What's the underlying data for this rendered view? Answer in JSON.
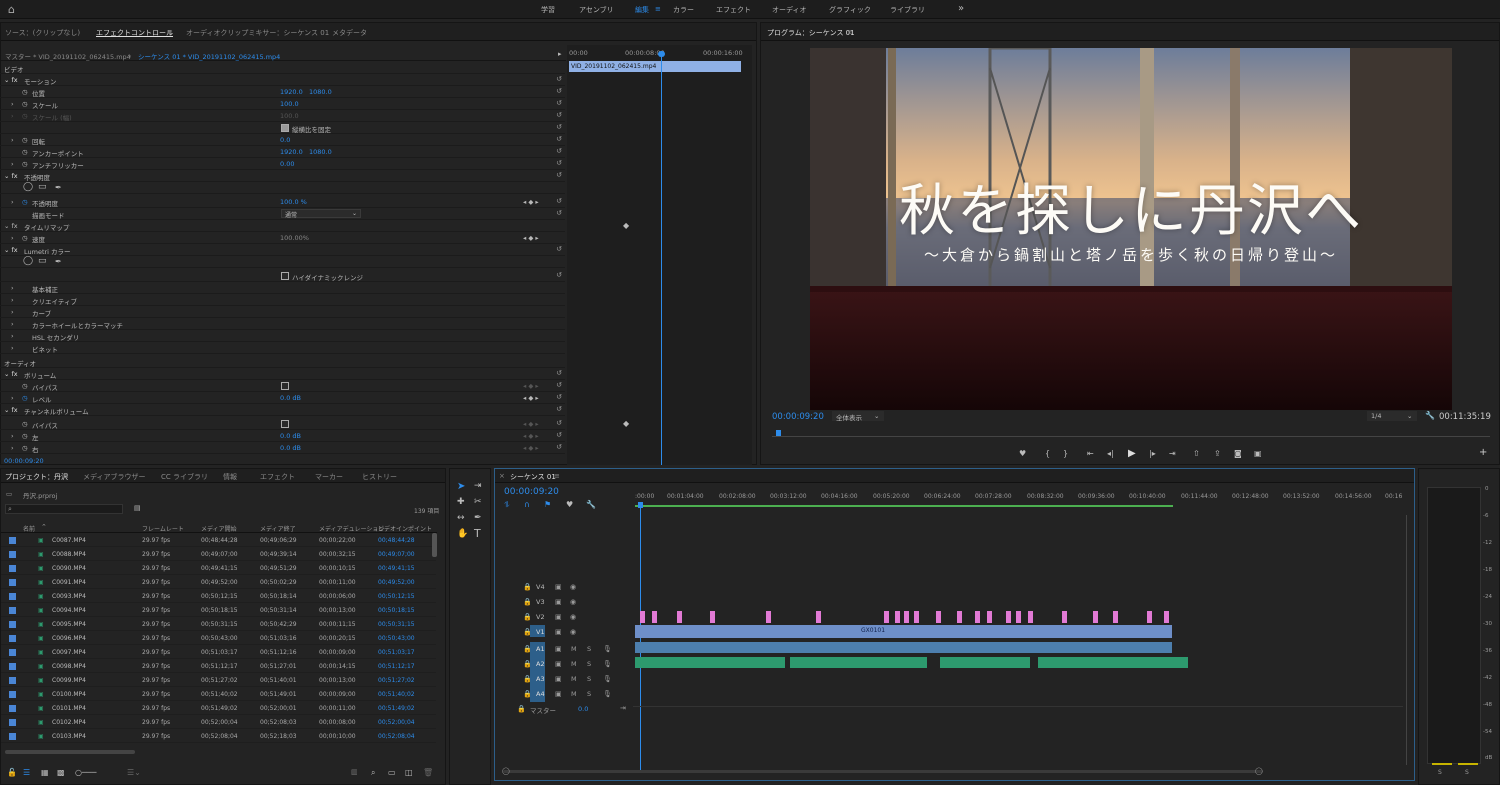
{
  "topbar": {
    "home": "⌂",
    "workspaces": [
      "学習",
      "アセンブリ",
      "編集",
      "カラー",
      "エフェクト",
      "オーディオ",
      "グラフィック",
      "ライブラリ"
    ],
    "active_index": 2,
    "more": "»"
  },
  "source_tabs": {
    "source": "ソース：(クリップなし)",
    "effect_controls": "エフェクトコントロール",
    "audio_mixer": "オーディオクリップミキサー：シーケンス 01",
    "metadata": "メタデータ"
  },
  "effect_controls": {
    "master": "マスター * VID_20191102_062415.mp4",
    "sequence": "シーケンス 01 * VID_20191102_062415.mp4",
    "timecodes": [
      "00:00",
      "00:00:08:00",
      "00:00:16:00"
    ],
    "clip_name": "VID_20191102_062415.mp4",
    "video_header": "ビデオ",
    "audio_header": "オーディオ",
    "current_time": "00:00:09:20",
    "motion": "モーション",
    "position": {
      "label": "位置",
      "x": "1920.0",
      "y": "1080.0"
    },
    "scale": {
      "label": "スケール",
      "value": "100.0"
    },
    "scale_width": {
      "label": "スケール (幅)",
      "value": "100.0"
    },
    "uniform_scale": "縦横比を固定",
    "rotation": {
      "label": "回転",
      "value": "0.0"
    },
    "anchor": {
      "label": "アンカーポイント",
      "x": "1920.0",
      "y": "1080.0"
    },
    "antiflicker": {
      "label": "アンチフリッカー",
      "value": "0.00"
    },
    "opacity": "不透明度",
    "opacity_value": {
      "label": "不透明度",
      "value": "100.0 %"
    },
    "blend": {
      "label": "描画モード",
      "value": "通常"
    },
    "timeremap": "タイムリマップ",
    "speed": {
      "label": "速度",
      "value": "100.00%"
    },
    "lumetri": "Lumetri カラー",
    "hdr": "ハイダイナミックレンジ",
    "lumetri_sections": [
      "基本補正",
      "クリエイティブ",
      "カーブ",
      "カラーホイールとカラーマッチ",
      "HSL セカンダリ",
      "ビネット"
    ],
    "volume": "ボリューム",
    "bypass": "バイパス",
    "level": {
      "label": "レベル",
      "value": "0.0 dB"
    },
    "channel_volume": "チャンネルボリューム",
    "left": {
      "label": "左",
      "value": "0.0 dB"
    },
    "right": {
      "label": "右",
      "value": "0.0 dB"
    }
  },
  "program": {
    "title": "プログラム：シーケンス 01",
    "main_title": "秋を探しに丹沢へ",
    "subtitle": "〜大倉から鍋割山と塔ノ岳を歩く秋の日帰り登山〜",
    "current_time": "00:00:09:20",
    "fit": "全体表示",
    "resolution": "1/4",
    "duration": "00:11:35:19"
  },
  "project": {
    "tabs": [
      "プロジェクト：丹沢",
      "メディアブラウザー",
      "CC ライブラリ",
      "情報",
      "エフェクト",
      "マーカー",
      "ヒストリー"
    ],
    "file": "丹沢.prproj",
    "item_count": "139 項目",
    "columns": [
      "名前",
      "フレームレート",
      "メディア開始",
      "メディア終了",
      "メディアデュレーション",
      "ビデオインポイント"
    ],
    "rows": [
      [
        "C0087.MP4",
        "29.97 fps",
        "00;48;44;28",
        "00;49;06;29",
        "00;00;22;00",
        "00;48;44;28"
      ],
      [
        "C0088.MP4",
        "29.97 fps",
        "00;49;07;00",
        "00;49;39;14",
        "00;00;32;15",
        "00;49;07;00"
      ],
      [
        "C0090.MP4",
        "29.97 fps",
        "00;49;41;15",
        "00;49;51;29",
        "00;00;10;15",
        "00;49;41;15"
      ],
      [
        "C0091.MP4",
        "29.97 fps",
        "00;49;52;00",
        "00;50;02;29",
        "00;00;11;00",
        "00;49;52;00"
      ],
      [
        "C0093.MP4",
        "29.97 fps",
        "00;50;12;15",
        "00;50;18;14",
        "00;00;06;00",
        "00;50;12;15"
      ],
      [
        "C0094.MP4",
        "29.97 fps",
        "00;50;18;15",
        "00;50;31;14",
        "00;00;13;00",
        "00;50;18;15"
      ],
      [
        "C0095.MP4",
        "29.97 fps",
        "00;50;31;15",
        "00;50;42;29",
        "00;00;11;15",
        "00;50;31;15"
      ],
      [
        "C0096.MP4",
        "29.97 fps",
        "00;50;43;00",
        "00;51;03;16",
        "00;00;20;15",
        "00;50;43;00"
      ],
      [
        "C0097.MP4",
        "29.97 fps",
        "00;51;03;17",
        "00;51;12;16",
        "00;00;09;00",
        "00;51;03;17"
      ],
      [
        "C0098.MP4",
        "29.97 fps",
        "00;51;12;17",
        "00;51;27;01",
        "00;00;14;15",
        "00;51;12;17"
      ],
      [
        "C0099.MP4",
        "29.97 fps",
        "00;51;27;02",
        "00;51;40;01",
        "00;00;13;00",
        "00;51;27;02"
      ],
      [
        "C0100.MP4",
        "29.97 fps",
        "00;51;40;02",
        "00;51;49;01",
        "00;00;09;00",
        "00;51;40;02"
      ],
      [
        "C0101.MP4",
        "29.97 fps",
        "00;51;49;02",
        "00;52;00;01",
        "00;00;11;00",
        "00;51;49;02"
      ],
      [
        "C0102.MP4",
        "29.97 fps",
        "00;52;00;04",
        "00;52;08;03",
        "00;00;08;00",
        "00;52;00;04"
      ],
      [
        "C0103.MP4",
        "29.97 fps",
        "00;52;08;04",
        "00;52;18;03",
        "00;00;10;00",
        "00;52;08;04"
      ]
    ]
  },
  "timeline": {
    "title": "シーケンス 01",
    "current_time": "00:00:09:20",
    "ruler": [
      ":00:00",
      "00:01:04:00",
      "00:02:08:00",
      "00:03:12:00",
      "00:04:16:00",
      "00:05:20:00",
      "00:06:24:00",
      "00:07:28:00",
      "00:08:32:00",
      "00:09:36:00",
      "00:10:40:00",
      "00:11:44:00",
      "00:12:48:00",
      "00:13:52:00",
      "00:14:56:00",
      "00:16"
    ],
    "video_tracks": [
      "V4",
      "V3",
      "V2",
      "V1"
    ],
    "audio_tracks": [
      "A1",
      "A2",
      "A3",
      "A4"
    ],
    "master": "マスター",
    "master_value": "0.0",
    "clip_label": "GX0101",
    "m": "M",
    "s": "S"
  },
  "meter": {
    "ticks": [
      "0",
      "-6",
      "-12",
      "-18",
      "-24",
      "-30",
      "-36",
      "-42",
      "-48",
      "-54",
      "dB"
    ],
    "s_left": "S",
    "s_right": "S"
  }
}
